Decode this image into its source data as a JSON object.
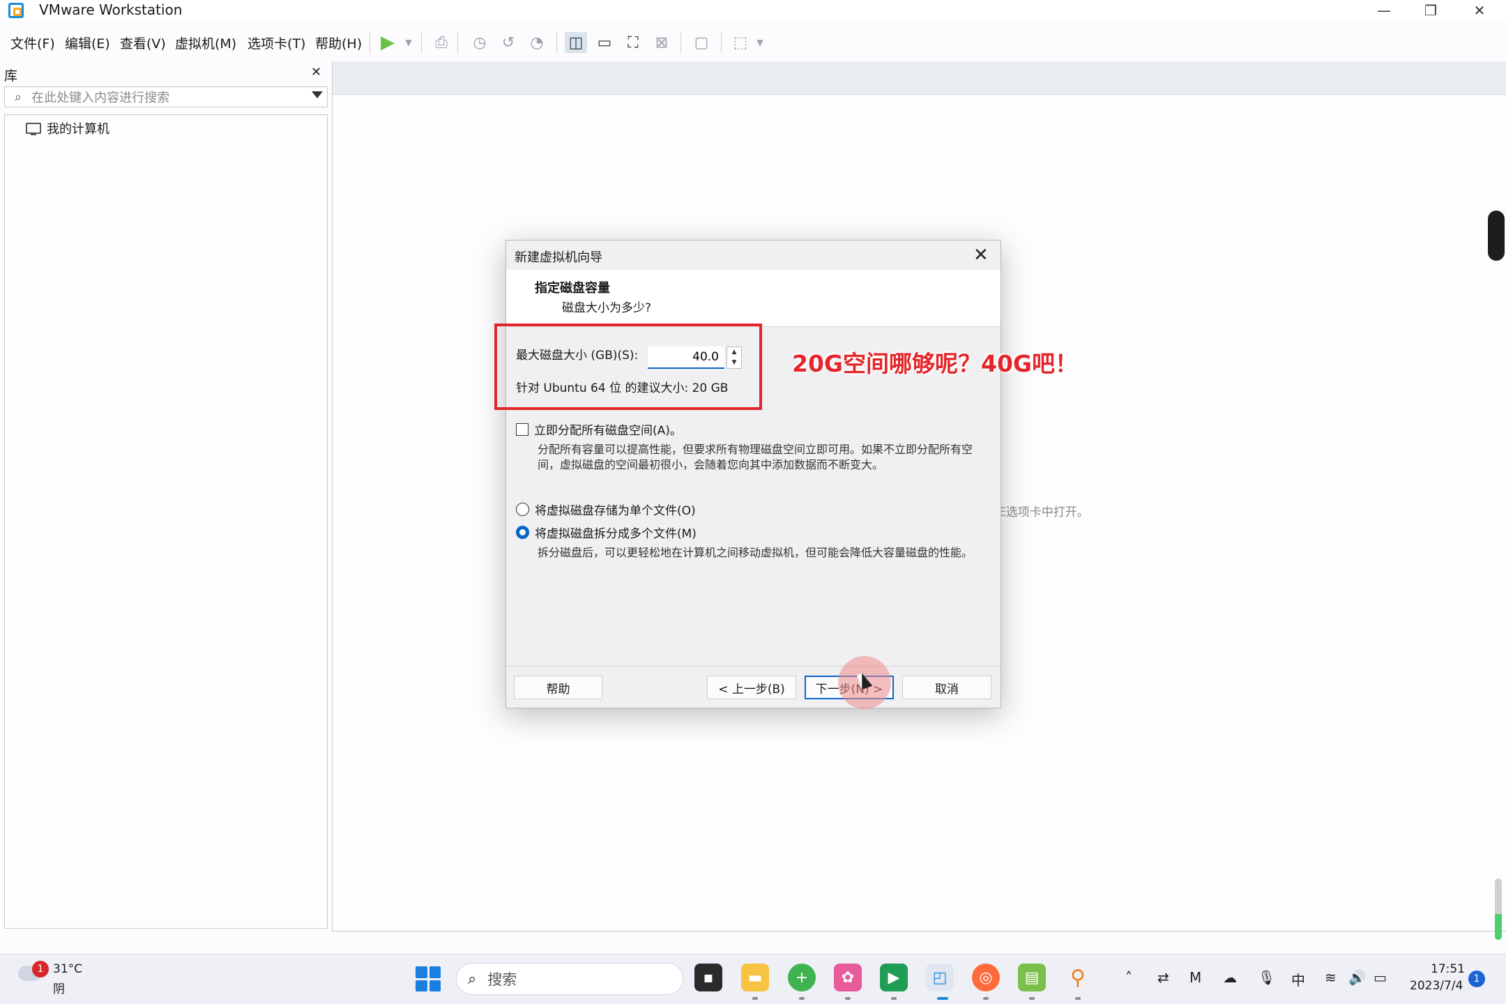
{
  "window": {
    "title": "VMware Workstation",
    "minimize_glyph": "—",
    "restore_glyph": "❐",
    "close_glyph": "✕"
  },
  "menu": {
    "items": [
      "文件(F)",
      "编辑(E)",
      "查看(V)",
      "虚拟机(M)",
      "选项卡(T)",
      "帮助(H)"
    ]
  },
  "toolbar": {
    "icons": [
      "play-icon",
      "print-icon",
      "snapshot-icon",
      "revert-icon",
      "manage-snapshot-icon",
      "sidebar-view-icon",
      "console-view-icon",
      "fullscreen-icon",
      "unity-icon",
      "terminal-icon",
      "stretch-icon"
    ]
  },
  "library": {
    "title": "库",
    "close": "✕",
    "search_placeholder": "在此处键入内容进行搜索",
    "tree": [
      "我的计算机"
    ]
  },
  "main": {
    "behind_text": "E选项卡中打开。"
  },
  "dialog": {
    "title": "新建虚拟机向导",
    "close": "✕",
    "heading": "指定磁盘容量",
    "subheading": "磁盘大小为多少?",
    "max_size_label": "最大磁盘大小 (GB)(S):",
    "max_size_value": "40.0",
    "recommend": "针对 Ubuntu 64 位 的建议大小: 20 GB",
    "allocate_label": "立即分配所有磁盘空间(A)。",
    "allocate_checked": false,
    "allocate_desc": "分配所有容量可以提高性能，但要求所有物理磁盘空间立即可用。如果不立即分配所有空间，虚拟磁盘的空间最初很小，会随着您向其中添加数据而不断变大。",
    "single_file_label": "将虚拟磁盘存储为单个文件(O)",
    "split_label": "将虚拟磁盘拆分成多个文件(M)",
    "selected_option": "split",
    "split_desc": "拆分磁盘后，可以更轻松地在计算机之间移动虚拟机，但可能会降低大容量磁盘的性能。",
    "buttons": {
      "help": "帮助",
      "back": "< 上一步(B)",
      "next": "下一步(N) >",
      "cancel": "取消"
    }
  },
  "annotation": {
    "text": "20G空间哪够呢？40G吧！",
    "color": "#e3262b"
  },
  "taskbar": {
    "weather_badge": "1",
    "temperature": "31°C",
    "condition": "阴",
    "search_label": "搜索",
    "ime": "中",
    "time": "17:51",
    "date": "2023/7/4",
    "notifications": "1"
  },
  "colors": {
    "accent": "#0a64c8",
    "highlight": "#e3262b",
    "start": "#1b7fe0"
  }
}
